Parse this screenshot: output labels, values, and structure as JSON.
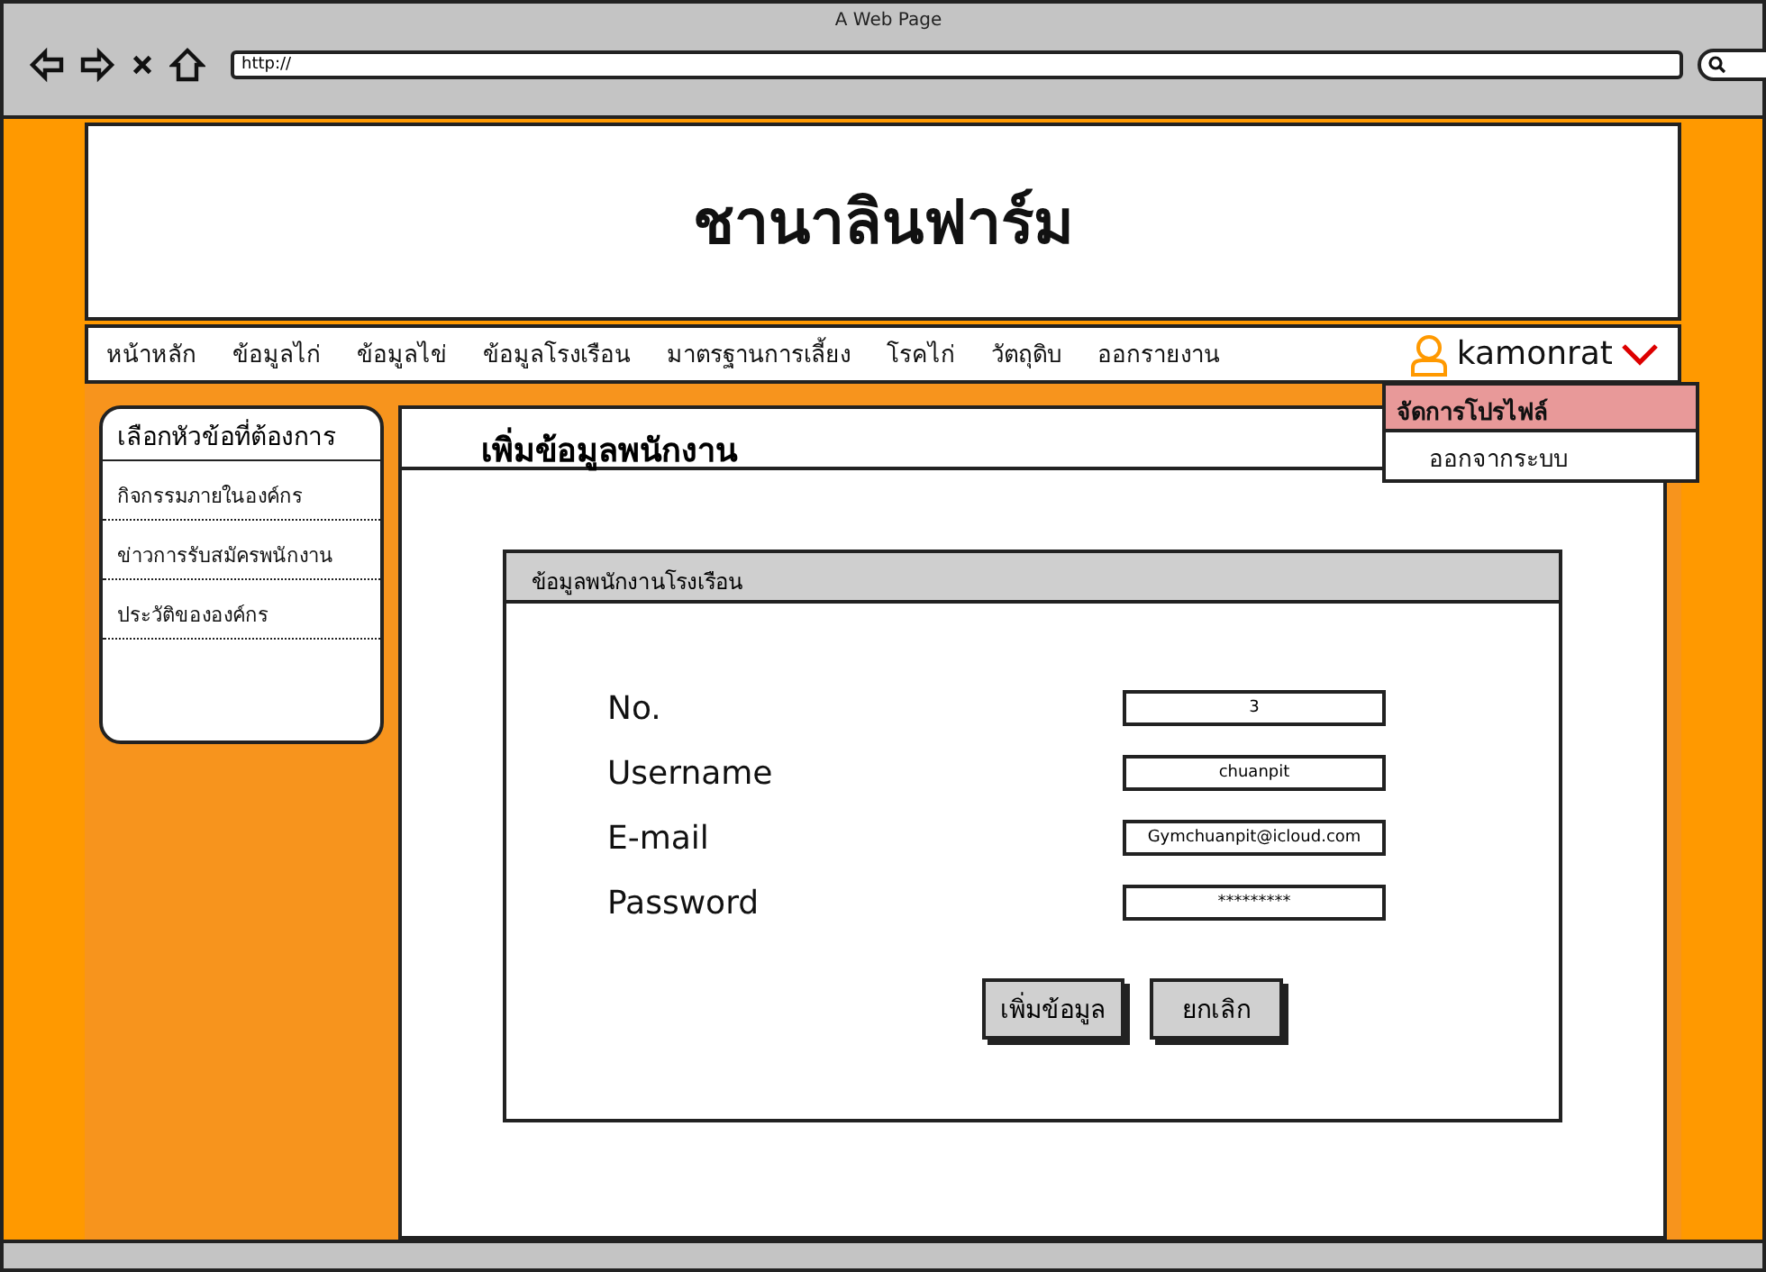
{
  "window": {
    "title": "A Web Page",
    "url": "http://"
  },
  "site": {
    "title": "ชานาลินฟาร์ม"
  },
  "nav": {
    "items": [
      {
        "label": "หน้าหลัก"
      },
      {
        "label": "ข้อมูลไก่"
      },
      {
        "label": "ข้อมูลไข่"
      },
      {
        "label": "ข้อมูลโรงเรือน"
      },
      {
        "label": "มาตรฐานการเลี้ยง"
      },
      {
        "label": "โรคไก่"
      },
      {
        "label": "วัตถุดิบ"
      },
      {
        "label": "ออกรายงาน"
      }
    ],
    "user": {
      "name": "kamonrat",
      "expanded": true
    },
    "user_menu": [
      {
        "label": "จัดการโปรไฟล์",
        "selected": true
      },
      {
        "label": "ออกจากระบบ",
        "selected": false
      }
    ]
  },
  "sidebar": {
    "title": "เลือกหัวข้อที่ต้องการ",
    "items": [
      {
        "label": "กิจกรรมภายในองค์กร"
      },
      {
        "label": "ข่าวการรับสมัครพนักงาน"
      },
      {
        "label": "ประวัติขององค์กร"
      }
    ]
  },
  "page": {
    "heading": "เพิ่มข้อมูลพนักงาน"
  },
  "form": {
    "title": "ข้อมูลพนักงานโรงเรือน",
    "fields": [
      {
        "label": "No.",
        "value": "3"
      },
      {
        "label": "Username",
        "value": "chuanpit"
      },
      {
        "label": "E-mail",
        "value": "Gymchuanpit@icloud.com"
      },
      {
        "label": "Password",
        "value": "*********"
      }
    ],
    "buttons": [
      {
        "label": "เพิ่มข้อมูล"
      },
      {
        "label": "ยกเลิก"
      }
    ]
  }
}
